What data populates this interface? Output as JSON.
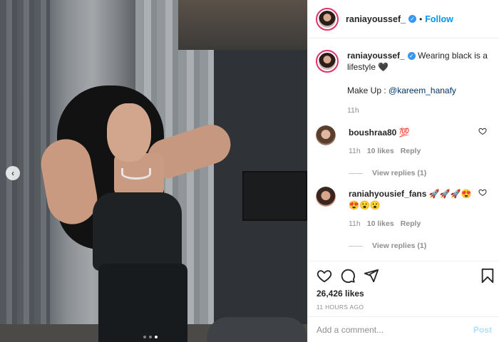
{
  "post": {
    "username": "raniayoussef_",
    "follow_label": "Follow",
    "separator": "•",
    "caption_text": "Wearing black is a lifestyle 🖤",
    "makeup_prefix": "Make Up : ",
    "makeup_mention": "@kareem_hanafy",
    "caption_time": "11h"
  },
  "comments": [
    {
      "username": "boushraa80",
      "text": "💯",
      "time": "11h",
      "likes": "10 likes",
      "reply_label": "Reply",
      "view_replies": "View replies (1)"
    },
    {
      "username": "raniahyousief_fans",
      "text": "🚀🚀🚀😍😍😮😮",
      "time": "11h",
      "likes": "10 likes",
      "reply_label": "Reply",
      "view_replies": "View replies (1)"
    }
  ],
  "stats": {
    "likes": "26,426 likes",
    "time_ago": "11 HOURS AGO"
  },
  "comment_box": {
    "placeholder": "Add a comment...",
    "post_label": "Post"
  },
  "carousel": {
    "prev_glyph": "‹",
    "dot_count": 3,
    "active_index": 2
  },
  "colors": {
    "accent": "#0095f6",
    "verified": "#3897f0",
    "muted": "#8e8e8e",
    "post_disabled": "#b2dffc"
  },
  "icons": [
    "heart-icon",
    "comment-icon",
    "share-icon",
    "bookmark-icon",
    "verified-icon",
    "chevron-left-icon"
  ]
}
